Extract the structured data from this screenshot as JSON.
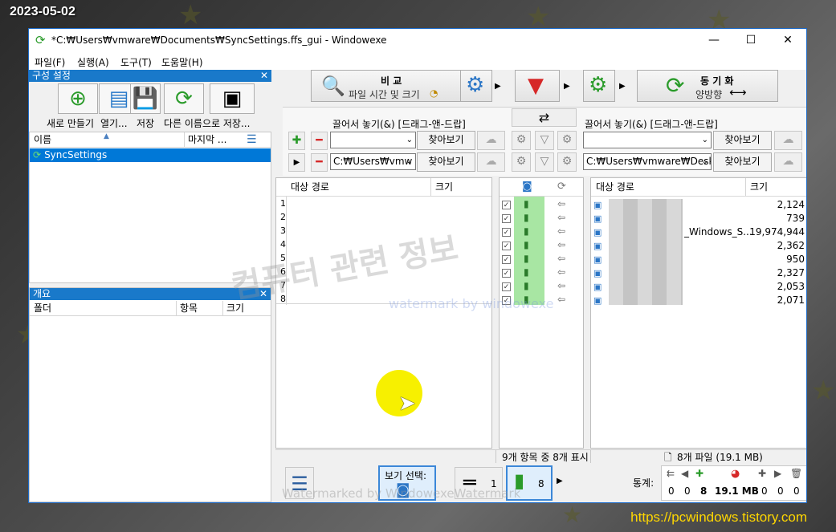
{
  "overlay": {
    "date": "2023-05-02",
    "url": "https://pcwindows.tistory.com"
  },
  "window": {
    "title": "*C:₩Users₩vmware₩Documents₩SyncSettings.ffs_gui - Windowexe",
    "min": "—",
    "max": "☐",
    "close": "✕"
  },
  "menu": [
    "파일(F)",
    "실행(A)",
    "도구(T)",
    "도움말(H)"
  ],
  "config_panel": {
    "title": "구성 설정",
    "buttons": [
      "새로 만들기",
      "열기...",
      "저장",
      "다른 이름으로 저장..."
    ],
    "col_name": "이름",
    "col_last": "마지막 ...",
    "items": [
      "SyncSettings"
    ]
  },
  "overview_panel": {
    "title": "개요",
    "col_folder": "폴더",
    "col_items": "항목",
    "col_size": "크기"
  },
  "toolbar": {
    "compare_label": "비  교",
    "compare_sub": "파일 시간 및 크기",
    "sync_label": "동  기  화",
    "sync_sub": "양방향"
  },
  "left_folder": {
    "drop_label": "끌어서 놓기(&) [드래그-앤-드랍]",
    "path": "C:₩Users₩vmw",
    "browse": "찾아보기"
  },
  "right_folder": {
    "drop_label": "끌어서 놓기(&) [드래그-앤-드랍]",
    "path": "C:₩Users₩vmware₩Deskt",
    "browse": "찾아보기"
  },
  "grid_left": {
    "col_path": "대상 경로",
    "col_size": "크기",
    "rows": [
      "1",
      "2",
      "3",
      "4",
      "5",
      "6",
      "7",
      "8"
    ]
  },
  "grid_right": {
    "col_path": "대상 경로",
    "col_size": "크기",
    "rows": [
      {
        "name": "",
        "size": "2,124"
      },
      {
        "name": "",
        "size": "739"
      },
      {
        "name": "_Windows_S...",
        "size": "19,974,944"
      },
      {
        "name": "",
        "size": "2,362"
      },
      {
        "name": "",
        "size": "950"
      },
      {
        "name": "",
        "size": "2,327"
      },
      {
        "name": "",
        "size": "2,053"
      },
      {
        "name": "",
        "size": "2,071"
      }
    ]
  },
  "status": {
    "middle": "9개 항목 중 8개 표시",
    "right": "8개 파일 (19.1 MB)"
  },
  "bottom": {
    "view_select": "보기 선택:",
    "equal_count": "1",
    "create_count": "8",
    "stats_label": "통계:",
    "stats": [
      "0",
      "0",
      "8",
      "19.1 MB",
      "0",
      "0",
      "0"
    ]
  },
  "watermarks": {
    "korean": "컴퓨터 관련 정보",
    "en1": "watermark by windowexe",
    "en2": "Watermarked by WindowexeWatermark"
  },
  "colors": {
    "accent": "#1979ca",
    "select": "#0078d7",
    "green": "#2a9b2a",
    "red": "#d62828"
  }
}
